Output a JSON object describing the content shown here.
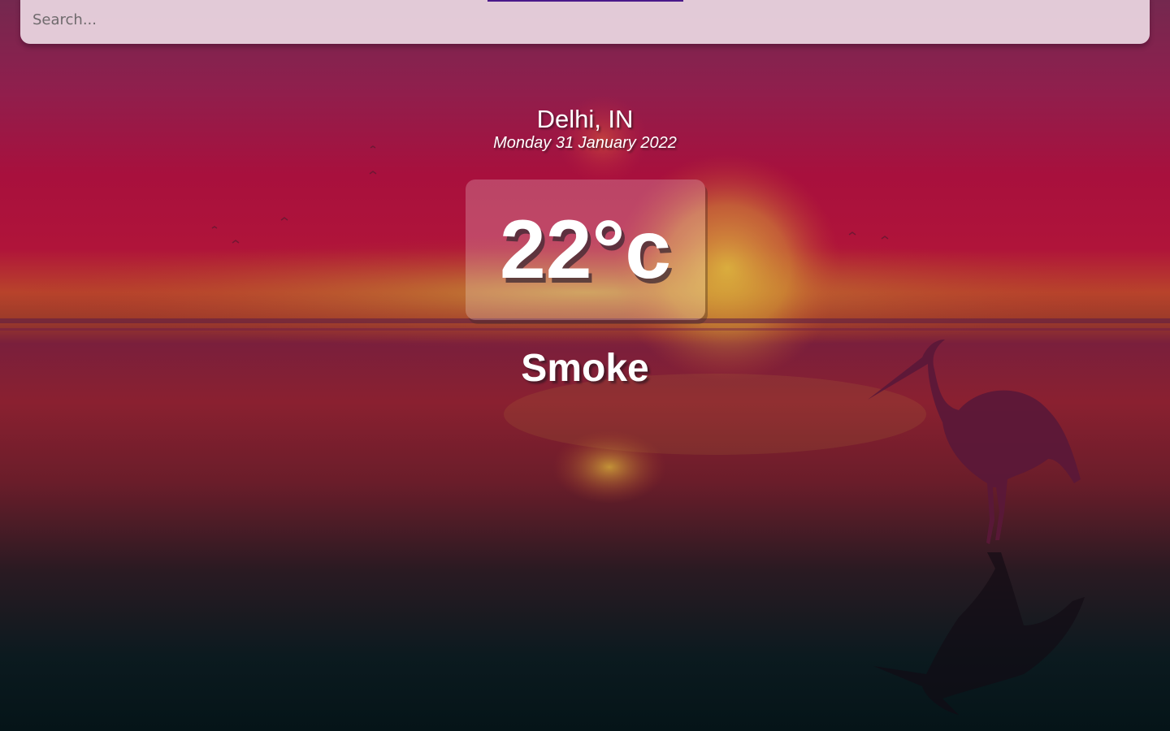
{
  "search": {
    "placeholder": "Search..."
  },
  "weather": {
    "location": "Delhi, IN",
    "date": "Monday 31 January 2022",
    "temperature": "22°c",
    "condition": "Smoke"
  },
  "icons": {
    "background": "sunset-heron-image"
  },
  "colors": {
    "sky_top": "#7a2a52",
    "sky_mid": "#a8123f",
    "horizon": "#c95a2a",
    "sun": "#d6b43a",
    "water_dark": "#061c22",
    "search_bg": "#ead6e0",
    "accent_underline": "#4a1a8a"
  }
}
